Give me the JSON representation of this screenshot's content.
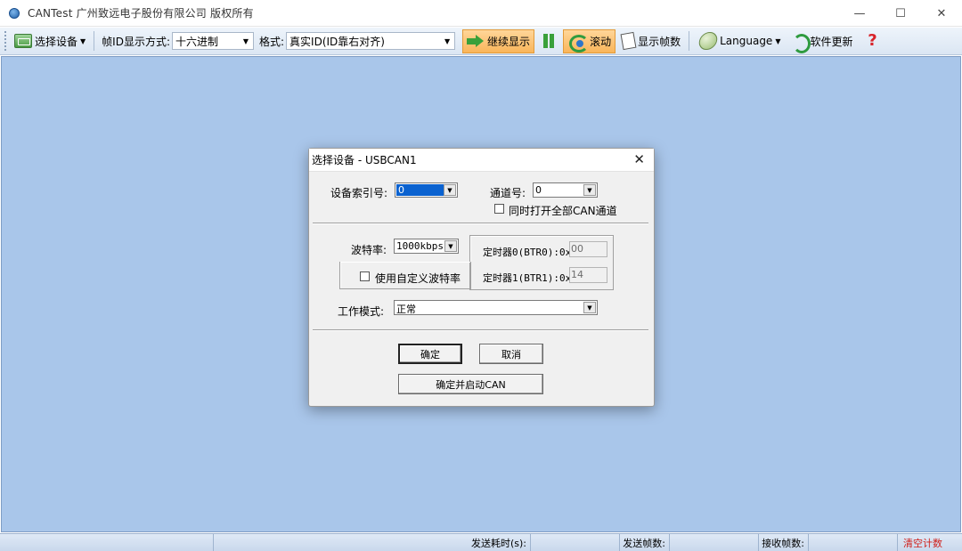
{
  "window": {
    "title": "CANTest    广州致远电子股份有限公司 版权所有",
    "minimize": "—",
    "maximize": "☐",
    "close": "✕"
  },
  "toolbar": {
    "select_device": "选择设备",
    "frame_id_label": "帧ID显示方式:",
    "frame_id_value": "十六进制",
    "format_label": "格式:",
    "format_value": "真实ID(ID靠右对齐)",
    "continue_display": "继续显示",
    "scroll": "滚动",
    "show_frames": "显示帧数",
    "language": "Language",
    "software_update": "软件更新",
    "help_icon_glyph": "?",
    "active_color": "#f9b55a"
  },
  "statusbar": {
    "send_time_label": "发送耗时(s):",
    "send_frames_label": "发送帧数:",
    "recv_frames_label": "接收帧数:",
    "clear_count": "清空计数"
  },
  "dialog": {
    "title": "选择设备 - USBCAN1",
    "close_glyph": "✕",
    "device_index_label": "设备索引号:",
    "device_index_value": "0",
    "channel_label": "通道号:",
    "channel_value": "0",
    "open_all_label": "同时打开全部CAN通道",
    "open_all_checked": false,
    "baud_label": "波特率:",
    "baud_value": "1000kbps",
    "custom_baud_label": "使用自定义波特率",
    "custom_baud_checked": false,
    "timer0_label": "定时器0(BTR0):0x",
    "timer0_value": "00",
    "timer1_label": "定时器1(BTR1):0x",
    "timer1_value": "14",
    "mode_label": "工作模式:",
    "mode_value": "正常",
    "ok_button": "确定",
    "cancel_button": "取消",
    "ok_start_button": "确定并启动CAN"
  },
  "colors": {
    "workspace": "#a9c6ea",
    "clear_text": "#d0201a",
    "selection": "#0a62d0"
  }
}
